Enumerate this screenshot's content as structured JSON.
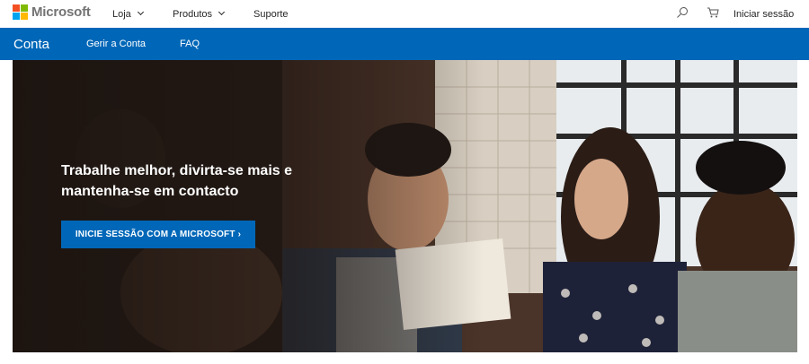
{
  "header": {
    "brand": "Microsoft",
    "nav": [
      {
        "label": "Loja",
        "has_dropdown": true
      },
      {
        "label": "Produtos",
        "has_dropdown": true
      },
      {
        "label": "Suporte",
        "has_dropdown": false
      }
    ],
    "search_icon": "search-icon",
    "cart_icon": "cart-icon",
    "signin_label": "Iniciar sessão"
  },
  "subnav": {
    "title": "Conta",
    "links": [
      "Gerir a Conta",
      "FAQ"
    ],
    "color": "#0067b8"
  },
  "hero": {
    "title": "Trabalhe melhor, divirta-se mais e mantenha-se em contacto",
    "cta_label": "INICIE SESSÃO COM A MICROSOFT ›",
    "cta_color": "#0067b8",
    "image_description": "photo-people-cafe"
  }
}
